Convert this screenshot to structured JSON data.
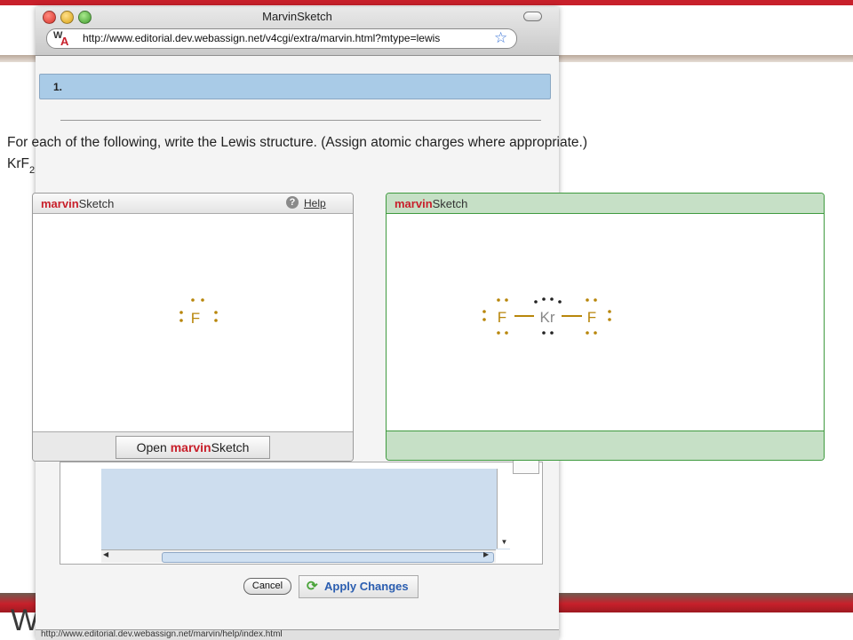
{
  "window": {
    "title": "MarvinSketch",
    "url": "http://www.editorial.dev.webassign.net/v4cgi/extra/marvin.html?mtype=lewis",
    "status_url": "http://www.editorial.dev.webassign.net/marvin/help/index.html"
  },
  "question": {
    "number": "1.",
    "prompt": "For each of the following, write the Lewis structure. (Assign atomic charges where appropriate.)",
    "formula_main": "KrF",
    "formula_sub": "2"
  },
  "editor_panel": {
    "brand_prefix": "marvin",
    "brand_suffix": "Sketch",
    "help_label": "Help",
    "open_button_prefix": "Open ",
    "open_button_brand": "marvin",
    "open_button_suffix": "Sketch",
    "atom_label": "F"
  },
  "answer_panel": {
    "brand_prefix": "marvin",
    "brand_suffix": "Sketch",
    "atoms": [
      "F",
      "Kr",
      "F"
    ]
  },
  "buttons": {
    "cancel": "Cancel",
    "apply": "Apply Changes"
  },
  "logo_text": "We",
  "colors": {
    "brand_red": "#c8202b",
    "question_bar": "#a9cbe7",
    "answer_green": "#c6e0c6",
    "electron_dots": "#b8860b",
    "link_blue": "#2a5db0"
  }
}
